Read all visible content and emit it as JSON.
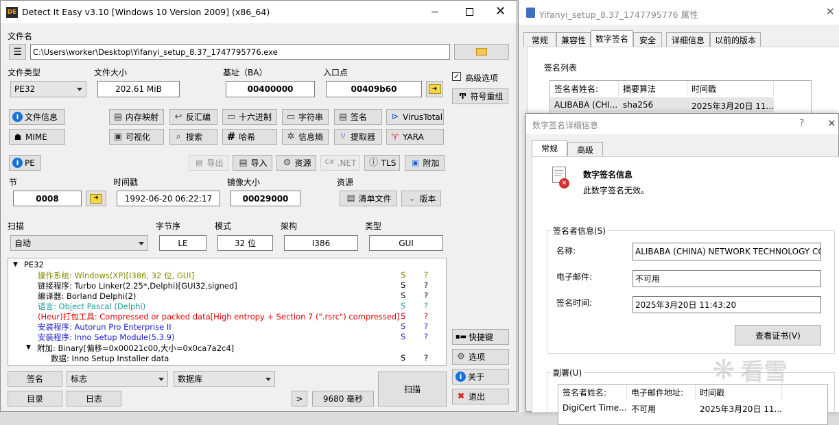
{
  "die": {
    "title": "Detect It Easy v3.10 [Windows 10 Version 2009] (x86_64)",
    "file_name_label": "文件名",
    "file_path": "C:\\Users\\worker\\Desktop\\Yifanyi_setup_8.37_1747795776.exe",
    "file_type_label": "文件类型",
    "file_type_value": "PE32",
    "file_size_label": "文件大小",
    "file_size_value": "202.61 MiB",
    "base_label": "基址（BA）",
    "base_value": "00400000",
    "entry_label": "入口点",
    "entry_value": "00409b60",
    "advanced_label": "高级选项",
    "symbol_label": "符号重组",
    "buttons_row1": [
      "文件信息",
      "内存映射",
      "反汇编",
      "十六进制",
      "字符串",
      "签名",
      "VirusTotal"
    ],
    "buttons_row2": [
      "MIME",
      "可视化",
      "搜索",
      "哈希",
      "信息熵",
      "提取器",
      "YARA"
    ],
    "pe_label": "PE",
    "export_label": "导出",
    "import_label": "导入",
    "resource_label": "资源",
    "net_label": ".NET",
    "tls_label": "TLS",
    "overlay_label": "附加",
    "section_label": "节",
    "section_value": "0008",
    "timestamp_label": "时间戳",
    "timestamp_value": "1992-06-20 06:22:17",
    "image_size_label": "镜像大小",
    "image_size_value": "00029000",
    "resources_label": "资源",
    "manifest_label": "清单文件",
    "version_label": "版本",
    "scan_label": "扫描",
    "scan_mode": "自动",
    "endian_label": "字节序",
    "endian_value": "LE",
    "mode_label": "模式",
    "mode_value": "32 位",
    "arch_label": "架构",
    "arch_value": "I386",
    "type_label": "类型",
    "type_value": "GUI",
    "tree_root": "PE32",
    "tree_rows": [
      {
        "prefix": "操作系统: ",
        "text": "Windows(XP)[I386, 32 位, GUI]",
        "color": "#8a8a00",
        "s": "S",
        "q": "?",
        "scolor": "#8a8a00"
      },
      {
        "prefix": "链接程序: ",
        "text": "Turbo Linker(2.25*,Delphi)[GUI32,signed]",
        "color": "#000000",
        "s": "S",
        "q": "?",
        "scolor": "#000000"
      },
      {
        "prefix": "编译器: ",
        "text": "Borland Delphi(2)",
        "color": "#000000",
        "s": "S",
        "q": "?",
        "scolor": "#000000"
      },
      {
        "prefix": "语言: ",
        "text": "Object Pascal (Delphi)",
        "color": "#1a9a9a",
        "s": "S",
        "q": "?",
        "scolor": "#1a9a9a"
      },
      {
        "prefix": "(Heur)打包工具: ",
        "text": "Compressed or packed data[High entropy + Section 7 (\".rsrc\") compressed]",
        "color": "#e00000",
        "s": "S",
        "q": "?",
        "scolor": "#e00000"
      },
      {
        "prefix": "安装程序: ",
        "text": "Autorun Pro Enterprise II",
        "color": "#1a1acc",
        "s": "S",
        "q": "?",
        "scolor": "#1a1acc"
      },
      {
        "prefix": "安装程序: ",
        "text": "Inno Setup Module(5.3.9)",
        "color": "#1a1acc",
        "s": "S",
        "q": "?",
        "scolor": "#1a1acc"
      }
    ],
    "overlay_row": "附加: Binary[偏移=0x00021c00,大小=0x0ca7a2c4]",
    "data_row": "数据: Inno Setup Installer data",
    "data_s": "S",
    "data_q": "?",
    "shortcut_label": "快捷键",
    "options_label": "选项",
    "about_label": "关于",
    "exit_label": "退出",
    "sign_label": "签名",
    "flags_label": "标志",
    "database_label": "数据库",
    "scan_button": "扫描",
    "dir_label": "目录",
    "log_label": "日志",
    "more_label": ">",
    "time_value": "9680 毫秒"
  },
  "props": {
    "title": "Yifanyi_setup_8.37_1747795776 属性",
    "tabs": [
      "常规",
      "兼容性",
      "数字签名",
      "安全",
      "详细信息",
      "以前的版本"
    ],
    "sig_list_label": "签名列表",
    "cols": [
      "签名者姓名:",
      "摘要算法",
      "时间戳"
    ],
    "row": [
      "ALIBABA (CHI...",
      "sha256",
      "2025年3月20日 11..."
    ]
  },
  "sig": {
    "title": "数字签名详细信息",
    "help": "?",
    "tabs": [
      "常规",
      "高级"
    ],
    "info_title": "数字签名信息",
    "info_sub": "此数字签名无效。",
    "signer_group": "签名者信息(S)",
    "name_label": "名称:",
    "name_value": "ALIBABA (CHINA) NETWORK TECHNOLOGY CO",
    "email_label": "电子邮件:",
    "email_value": "不可用",
    "time_label": "签名时间:",
    "time_value": "2025年3月20日 11:43:20",
    "view_cert": "查看证书(V)",
    "counter_group": "副署(U)",
    "counter_cols": [
      "签名者姓名:",
      "电子邮件地址:",
      "时间戳"
    ],
    "counter_row": [
      "DigiCert Time...",
      "不可用",
      "2025年3月20日 11..."
    ],
    "watermark": "看雪"
  }
}
